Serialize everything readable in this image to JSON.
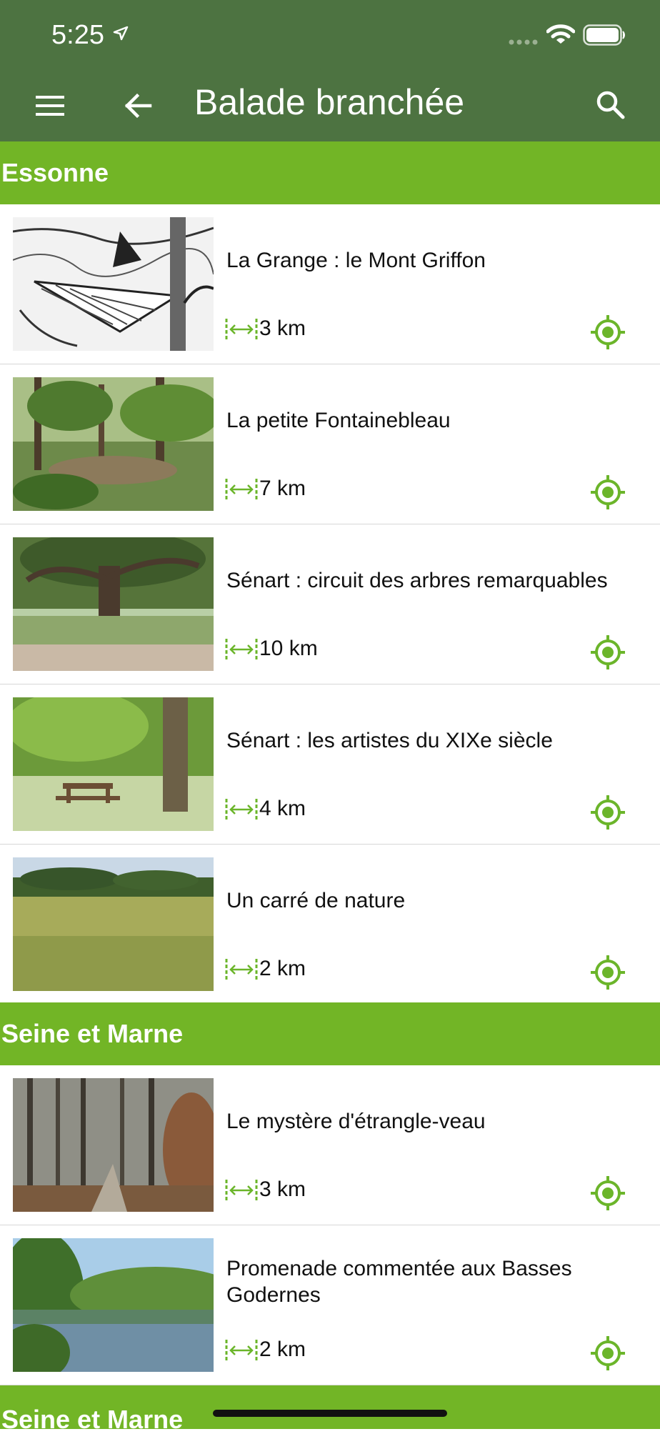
{
  "status_bar": {
    "time": "5:25"
  },
  "app_bar": {
    "title": "Balade branchée"
  },
  "sections": [
    {
      "name": "Essonne",
      "walks": [
        {
          "title": "La Grange : le Mont Griffon",
          "distance": "3 km"
        },
        {
          "title": "La petite Fontainebleau",
          "distance": "7 km"
        },
        {
          "title": "Sénart : circuit des arbres remarquables",
          "distance": "10 km"
        },
        {
          "title": "Sénart : les artistes du XIXe siècle",
          "distance": "4 km"
        },
        {
          "title": "Un carré de nature",
          "distance": "2 km"
        }
      ]
    },
    {
      "name": "Seine et Marne",
      "walks": [
        {
          "title": "Le mystère d'étrangle-veau",
          "distance": "3 km"
        },
        {
          "title": "Promenade commentée aux Basses Godernes",
          "distance": "2 km"
        }
      ]
    },
    {
      "name": "Seine et Marne"
    }
  ],
  "colors": {
    "app_bar": "#4d7341",
    "section": "#72b526",
    "accent": "#6bb52a"
  },
  "icons": [
    "menu-icon",
    "back-arrow-icon",
    "search-icon",
    "distance-icon",
    "locate-icon"
  ]
}
